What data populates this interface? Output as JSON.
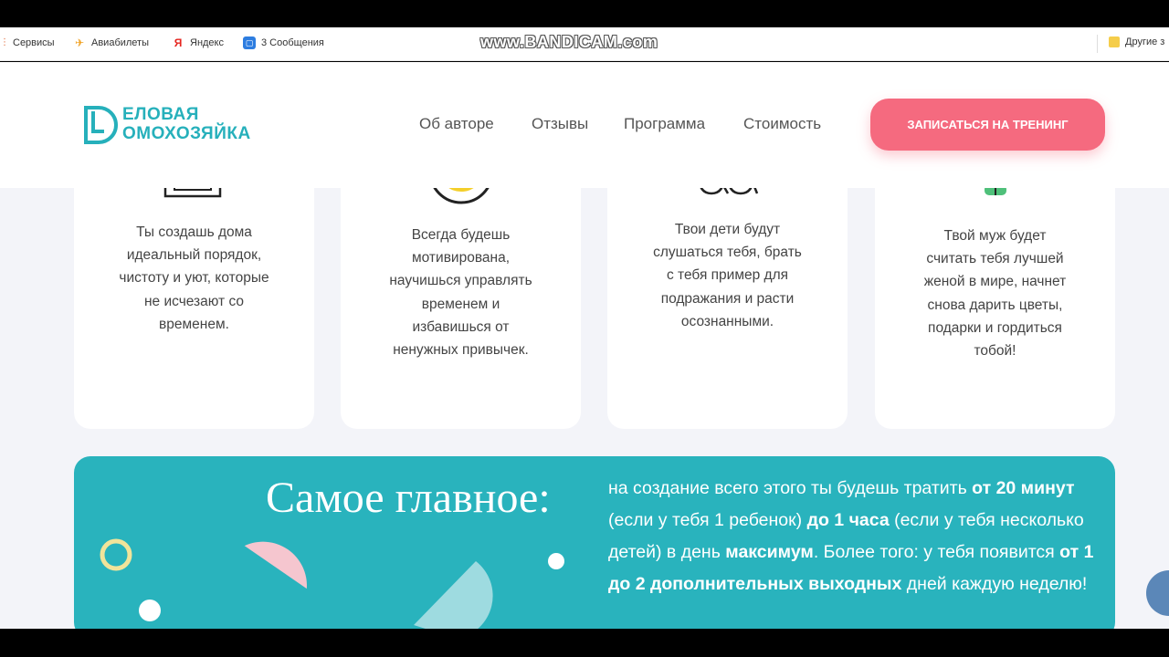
{
  "browser": {
    "bookmarks": [
      {
        "label": "Сервисы",
        "icon": "apps-grid-icon"
      },
      {
        "label": "Авиабилеты",
        "icon": "airplane-icon"
      },
      {
        "label": "Яндекс",
        "icon": "yandex-icon"
      },
      {
        "label": "3 Сообщения",
        "icon": "messages-icon"
      }
    ],
    "other_bookmarks": "Другие з",
    "watermark": "www.BANDICAM.com"
  },
  "header": {
    "logo_line1": "ЕЛОВАЯ",
    "logo_line2": "ОМОХОЗЯЙКА",
    "nav": [
      "Об авторе",
      "Отзывы",
      "Программа",
      "Стоимость"
    ],
    "cta_label": "ЗАПИСАТЬСЯ НА ТРЕНИНГ"
  },
  "cards": [
    {
      "icon": "home-plant-icon",
      "lines": [
        "Ты создашь дома",
        "идеальный порядок,",
        "чистоту и уют, которые",
        "не исчезают со",
        "временем."
      ]
    },
    {
      "icon": "sun-icon",
      "lines": [
        "Всегда будешь",
        "мотивирована,",
        "научишься управлять",
        "временем и",
        "избавишься от",
        "ненужных привычек."
      ]
    },
    {
      "icon": "children-icon",
      "lines": [
        "Твои дети будут",
        "слушаться тебя, брать",
        "с тебя пример для",
        "подражания и расти",
        "осознанными."
      ]
    },
    {
      "icon": "flower-gift-icon",
      "lines": [
        "Твой муж будет",
        "считать тебя лучшей",
        "женой в мире, начнет",
        "снова дарить цветы,",
        "подарки и гордиться",
        "тобой!"
      ]
    }
  ],
  "banner": {
    "title": "Самое главное:",
    "text_parts": {
      "p1": "на создание всего этого ты будешь тратить ",
      "b1": "от 20 минут",
      "p2": " (если у тебя 1 ребенок) ",
      "b2": "до 1 часа",
      "p3": " (если у тебя несколько детей) в день ",
      "b3": "максимум",
      "p4": ". Более того: у тебя появится ",
      "b4": "от 1 до 2 дополнительных выходных",
      "p5": " дней каждую неделю!"
    }
  },
  "colors": {
    "accent_teal": "#29b3bd",
    "cta_pink": "#f56a7f",
    "page_bg": "#f3f4f9"
  }
}
